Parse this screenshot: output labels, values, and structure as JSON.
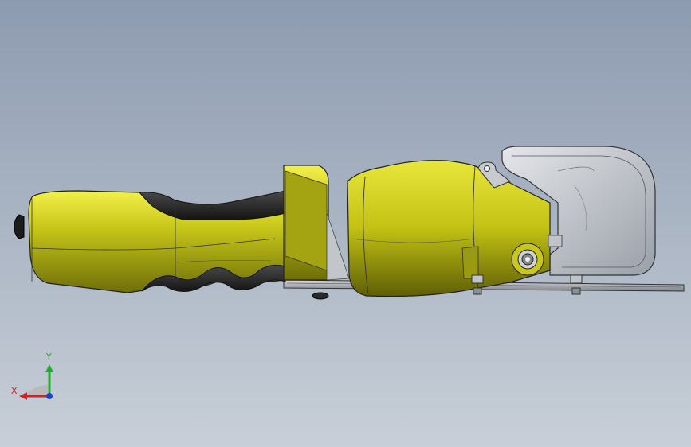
{
  "viewport": {
    "background_top": "#8d9bb0",
    "background_bottom": "#c8cfd8"
  },
  "model": {
    "body_color": "#c9c81a",
    "grip_color": "#2a2a2a",
    "metal_color": "#b9bec4",
    "guard_color": "#c7cbd0"
  },
  "triad": {
    "x_label": "X",
    "y_label": "Y",
    "x_color": "#d42020",
    "y_color": "#1fae2a",
    "z_color": "#1f3fd6"
  }
}
